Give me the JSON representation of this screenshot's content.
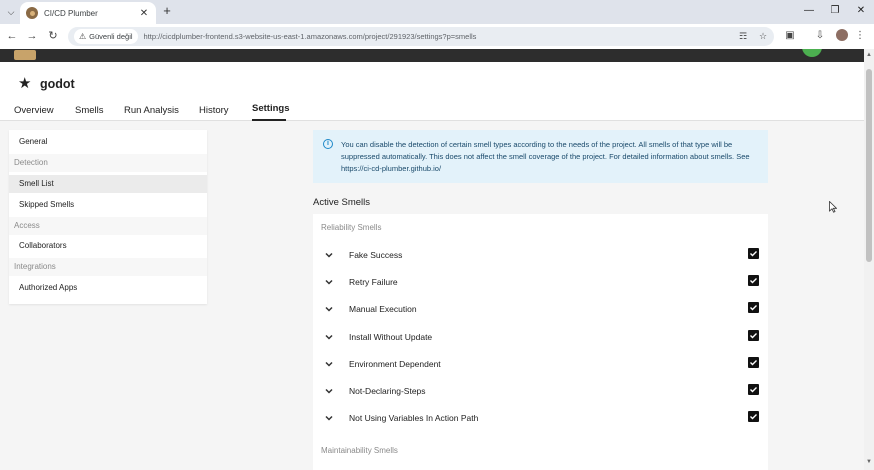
{
  "browser": {
    "tab_title": "CI/CD Plumber",
    "security_label": "Güvenli değil",
    "url": "http://cicdplumber-frontend.s3-website-us-east-1.amazonaws.com/project/291923/settings?p=smells"
  },
  "project": {
    "name": "godot",
    "tabs": [
      "Overview",
      "Smells",
      "Run Analysis",
      "History",
      "Settings"
    ],
    "active_tab": "Settings"
  },
  "sidebar": {
    "general": "General",
    "detection_header": "Detection",
    "smell_list": "Smell List",
    "skipped_smells": "Skipped Smells",
    "access_header": "Access",
    "collaborators": "Collaborators",
    "integrations_header": "Integrations",
    "authorized_apps": "Authorized Apps",
    "active_item": "Smell List"
  },
  "info": {
    "text": "You can disable the detection of certain smell types according to the needs of the project. All smells of that type will be suppressed automatically. This does not affect the smell coverage of the project. For detailed information about smells. See https://ci-cd-plumber.github.io/"
  },
  "smells": {
    "title": "Active Smells",
    "reliability_label": "Reliability Smells",
    "maintainability_label": "Maintainability Smells",
    "reliability": [
      {
        "name": "Fake Success",
        "checked": true
      },
      {
        "name": "Retry Failure",
        "checked": true
      },
      {
        "name": "Manual Execution",
        "checked": true
      },
      {
        "name": "Install Without Update",
        "checked": true
      },
      {
        "name": "Environment Dependent",
        "checked": true
      },
      {
        "name": "Not-Declaring-Steps",
        "checked": true
      },
      {
        "name": "Not Using Variables In Action Path",
        "checked": true
      }
    ]
  },
  "colors": {
    "info_bg": "#e3f2fa",
    "info_accent": "#1e88c8",
    "header_bg": "#2d2d2d"
  }
}
